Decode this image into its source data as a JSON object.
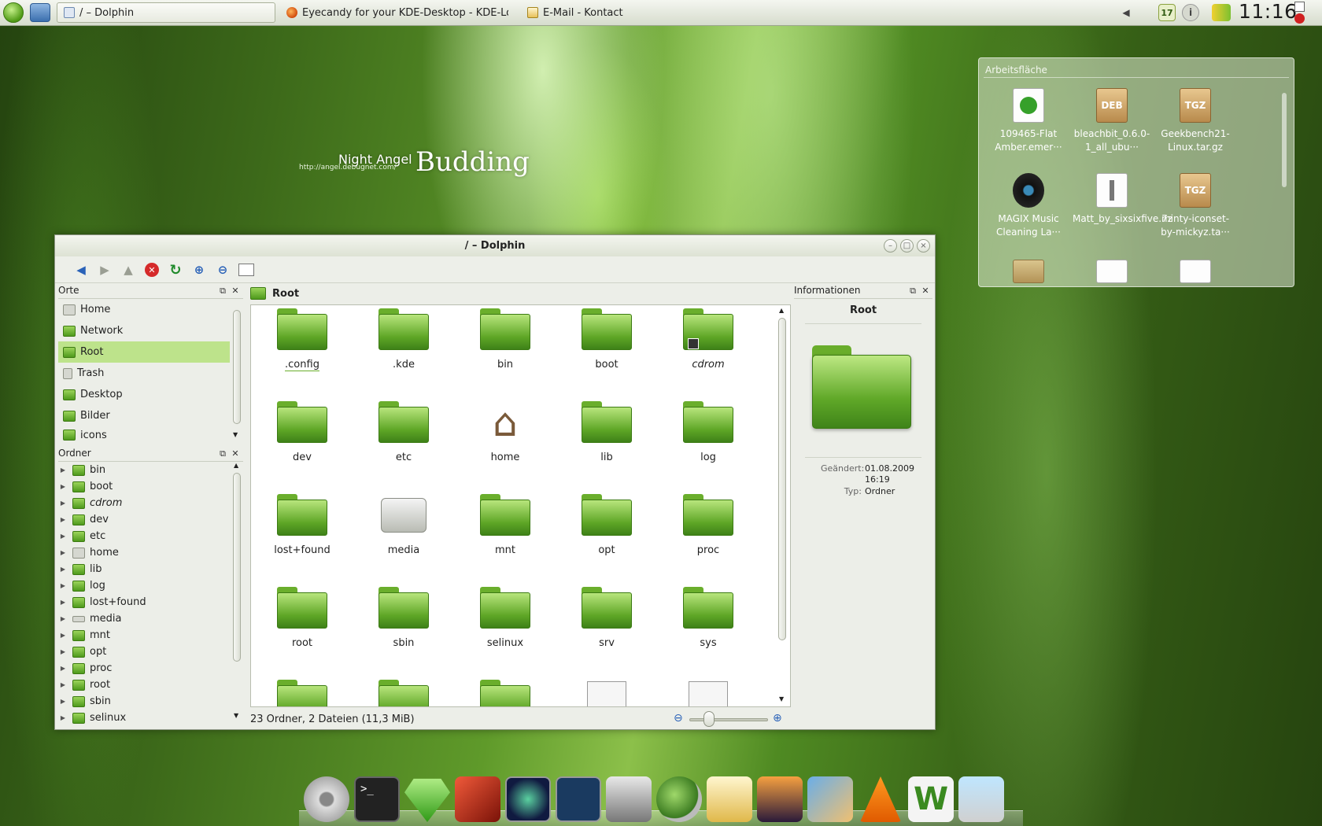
{
  "taskbar": {
    "tasks": [
      {
        "label": "/ – Dolphin"
      },
      {
        "label": "Eyecandy for your KDE-Desktop - KDE-Look.o"
      },
      {
        "label": "E-Mail - Kontact"
      }
    ],
    "tray_badge": "17",
    "clock": "11:16"
  },
  "wallpaper": {
    "small_title": "Night Angel",
    "url": "http://angel.debugnet.com/",
    "big_title": "Budding"
  },
  "desktop_widget": {
    "title": "Arbeitsfläche",
    "items": [
      {
        "label": "109465-Flat Amber.emer···",
        "icon": "document-icon",
        "badge": ""
      },
      {
        "label": "bleachbit_0.6.0-1_all_ubu···",
        "icon": "package-icon",
        "badge": "DEB"
      },
      {
        "label": "Geekbench21-Linux.tar.gz",
        "icon": "package-icon",
        "badge": "TGZ"
      },
      {
        "label": "MAGIX Music Cleaning La···",
        "icon": "disc-icon",
        "badge": ""
      },
      {
        "label": "Matt_by_sixsixfive.7z",
        "icon": "zip-icon",
        "badge": ""
      },
      {
        "label": "minty-iconset-by-mickyz.ta···",
        "icon": "package-icon",
        "badge": "TGZ"
      }
    ]
  },
  "dolphin": {
    "title": "/ – Dolphin",
    "places": {
      "title": "Orte",
      "items": [
        {
          "label": "Home",
          "icon": "home-icon"
        },
        {
          "label": "Network",
          "icon": "network-icon"
        },
        {
          "label": "Root",
          "icon": "folder-icon",
          "selected": true
        },
        {
          "label": "Trash",
          "icon": "trash-icon"
        },
        {
          "label": "Desktop",
          "icon": "folder-icon"
        },
        {
          "label": "Bilder",
          "icon": "folder-icon"
        },
        {
          "label": "icons",
          "icon": "folder-icon"
        }
      ]
    },
    "folders": {
      "title": "Ordner",
      "items": [
        "bin",
        "boot",
        "cdrom",
        "dev",
        "etc",
        "home",
        "lib",
        "log",
        "lost+found",
        "media",
        "mnt",
        "opt",
        "proc",
        "root",
        "sbin",
        "selinux"
      ]
    },
    "location": "Root",
    "files": [
      {
        "name": ".config",
        "icon": "folder-icon"
      },
      {
        "name": ".kde",
        "icon": "folder-icon"
      },
      {
        "name": "bin",
        "icon": "folder-icon"
      },
      {
        "name": "boot",
        "icon": "folder-icon"
      },
      {
        "name": "cdrom",
        "icon": "folder-link-icon"
      },
      {
        "name": "dev",
        "icon": "folder-icon"
      },
      {
        "name": "etc",
        "icon": "folder-icon"
      },
      {
        "name": "home",
        "icon": "home-icon"
      },
      {
        "name": "lib",
        "icon": "folder-icon"
      },
      {
        "name": "log",
        "icon": "folder-icon"
      },
      {
        "name": "lost+found",
        "icon": "folder-icon"
      },
      {
        "name": "media",
        "icon": "drive-icon"
      },
      {
        "name": "mnt",
        "icon": "folder-icon"
      },
      {
        "name": "opt",
        "icon": "folder-icon"
      },
      {
        "name": "proc",
        "icon": "folder-icon"
      },
      {
        "name": "root",
        "icon": "folder-icon"
      },
      {
        "name": "sbin",
        "icon": "folder-icon"
      },
      {
        "name": "selinux",
        "icon": "folder-icon"
      },
      {
        "name": "srv",
        "icon": "folder-icon"
      },
      {
        "name": "sys",
        "icon": "folder-icon"
      }
    ],
    "info": {
      "title": "Informationen",
      "name": "Root",
      "modified_label": "Geändert:",
      "modified_value": "01.08.2009 16:19",
      "type_label": "Typ:",
      "type_value": "Ordner"
    },
    "status": "23 Ordner, 2 Dateien (11,3 MiB)"
  },
  "colors": {
    "accent_green": "#5ea626",
    "selection": "#bde38b",
    "window_bg": "#eceee8"
  }
}
